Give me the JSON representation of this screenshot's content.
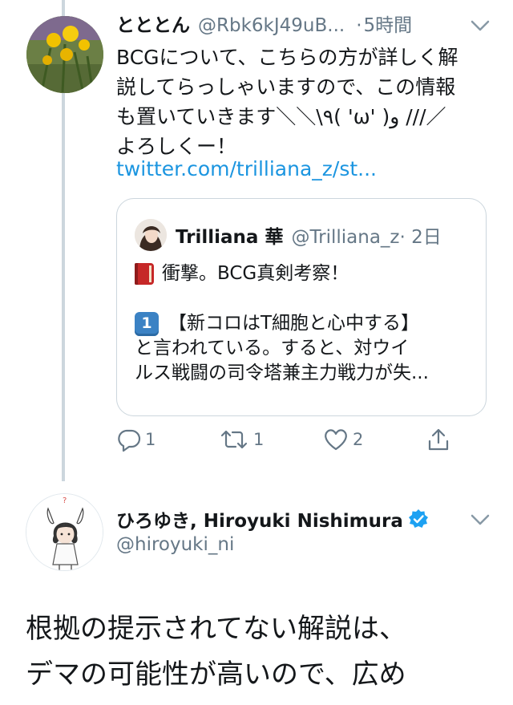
{
  "tweet1": {
    "author_name": "とととん",
    "handle": "@Rbk6kJ49uB...",
    "separator": "·",
    "time": "5時間",
    "lines": [
      "BCGについて、こちらの方が詳しく解",
      "説してらっしゃいますので、この情報",
      "も置いていきます＼＼\\٩( 'ω' )و ///／",
      "よろしくー！"
    ],
    "link": "twitter.com/trilliana_z/st...",
    "quote": {
      "author_name": "Trilliana 華",
      "handle": "@Trilliana_z",
      "time": "· 2日",
      "line1": "衝撃。BCG真剣考察！",
      "keycap_label": "1",
      "line2": "【新コロはT細胞と心中する】",
      "line3": "と言われている。すると、対ウイ",
      "line4": "ルス戦闘の司令塔兼主力戦力が失..."
    },
    "actions": {
      "reply_count": "1",
      "retweet_count": "1",
      "like_count": "2"
    }
  },
  "tweet2": {
    "author_name": "ひろゆき, Hiroyuki Nishimura",
    "handle": "@hiroyuki_ni",
    "lines": [
      "根拠の提示されてない解説は、",
      "デマの可能性が高いので、広め"
    ]
  },
  "colors": {
    "text": "#14171a",
    "secondary": "#657786",
    "link": "#1b95e0",
    "border": "#ccd6dd",
    "verified": "#1da1f2"
  },
  "icons": [
    "chevron-down-icon",
    "reply-icon",
    "retweet-icon",
    "like-icon",
    "share-icon",
    "verified-badge-icon",
    "book-emoji",
    "keycap-one-emoji"
  ]
}
